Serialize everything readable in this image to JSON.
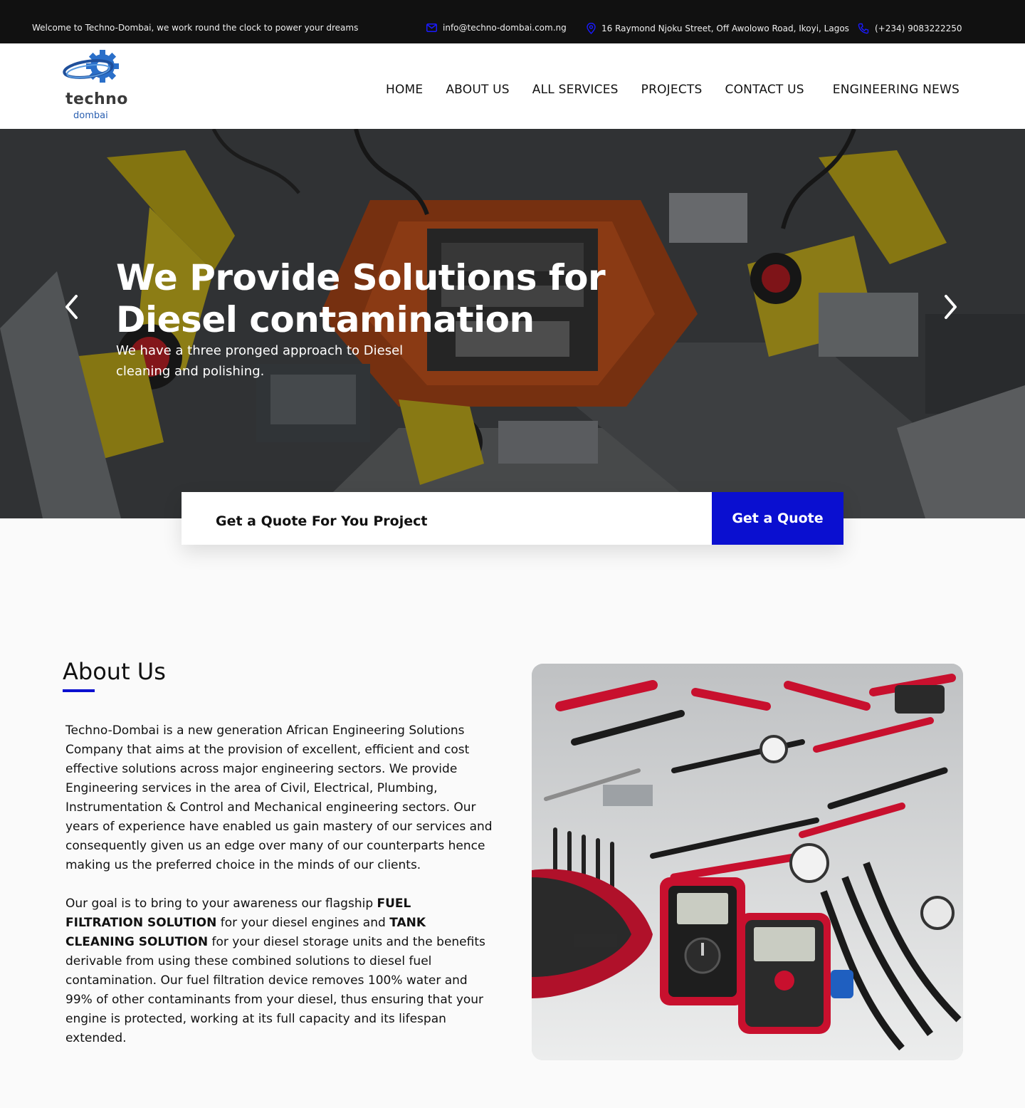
{
  "topbar": {
    "welcome": "Welcome to Techno-Dombai, we work round the clock to power your dreams",
    "email": "info@techno-dombai.com.ng",
    "address": "16 Raymond Njoku Street, Off Awolowo Road, Ikoyi, Lagos",
    "phone": "(+234) 9083222250",
    "icon_color": "#1a1aff"
  },
  "logo": {
    "word1": "techno",
    "word2": "dombai",
    "icon": "gear-icon"
  },
  "nav": {
    "items": [
      "HOME",
      "ABOUT US",
      "ALL SERVICES",
      "PROJECTS",
      "CONTACT US",
      "ENGINEERING NEWS"
    ]
  },
  "hero": {
    "title": "We Provide Solutions for Diesel contamination",
    "subtitle": "We have a three pronged approach to Diesel cleaning and polishing.",
    "prev_icon": "chevron-left-icon",
    "next_icon": "chevron-right-icon"
  },
  "quote": {
    "text": "Get a Quote For You Project",
    "button": "Get a Quote",
    "accent": "#0a0fd0"
  },
  "about": {
    "title": "About Us",
    "para1": "Techno-Dombai is a new generation African Engineering Solutions Company that aims at the provision of excellent, efficient and cost effective solutions across major engineering sectors. We provide Engineering services in the area of Civil, Electrical, Plumbing, Instrumentation & Control and Mechanical engineering sectors. Our years of experience have enabled us gain mastery of our services and consequently given us an edge over many of our counterparts hence making us the preferred choice in the minds of our clients.",
    "para2_a": "Our goal is to bring to your awareness our flagship ",
    "para2_b": "FUEL FILTRATION SOLUTION",
    "para2_c": " for your diesel engines and ",
    "para2_d": "TANK CLEANING SOLUTION",
    "para2_e": " for your diesel storage units and the benefits derivable from using these combined solutions to diesel fuel contamination. Our fuel filtration device removes 100% water and 99% of other contaminants from your diesel, thus ensuring that your engine is protected, working at its full capacity and its lifespan extended."
  }
}
